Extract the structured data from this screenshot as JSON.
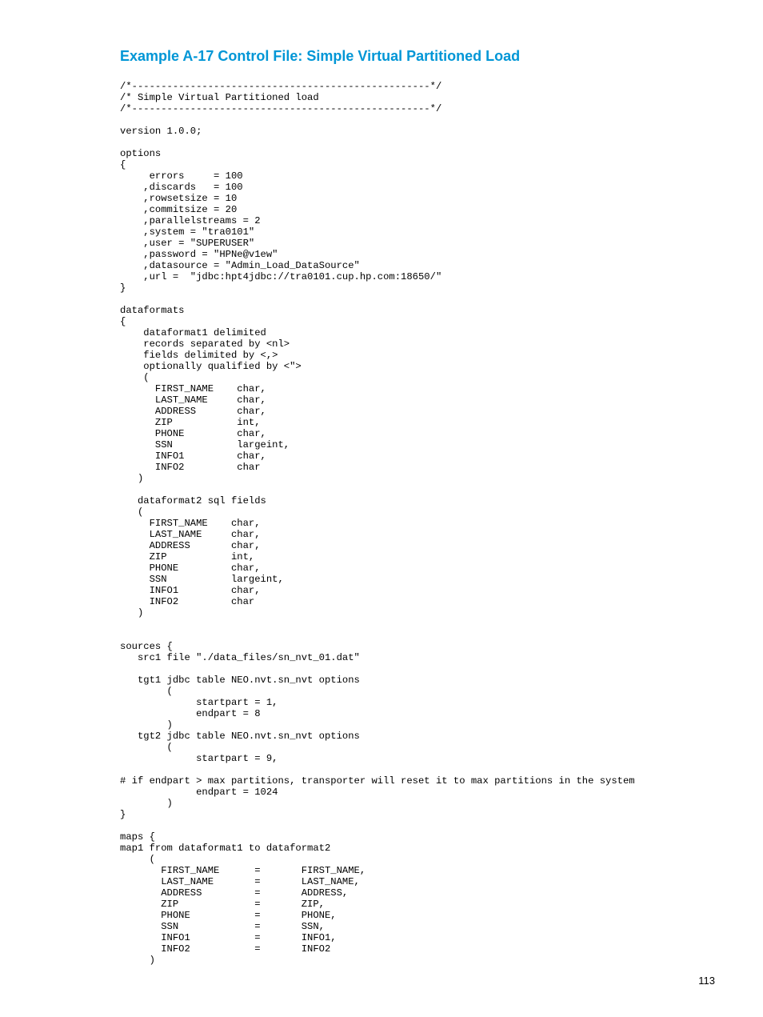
{
  "title": "Example A-17 Control File: Simple Virtual Partitioned Load",
  "code": "/*---------------------------------------------------*/\n/* Simple Virtual Partitioned load\n/*---------------------------------------------------*/\n\nversion 1.0.0;\n\noptions\n{\n     errors     = 100\n    ,discards   = 100\n    ,rowsetsize = 10\n    ,commitsize = 20\n    ,parallelstreams = 2\n    ,system = \"tra0101\"\n    ,user = \"SUPERUSER\"\n    ,password = \"HPNe@v1ew\"\n    ,datasource = \"Admin_Load_DataSource\"\n    ,url =  \"jdbc:hpt4jdbc://tra0101.cup.hp.com:18650/\"\n}\n\ndataformats\n{\n    dataformat1 delimited\n    records separated by <nl>\n    fields delimited by <,>\n    optionally qualified by <\">\n    (\n      FIRST_NAME    char,\n      LAST_NAME     char,\n      ADDRESS       char,\n      ZIP           int,\n      PHONE         char,\n      SSN           largeint,\n      INFO1         char,\n      INFO2         char\n   )\n\n   dataformat2 sql fields\n   (\n     FIRST_NAME    char,\n     LAST_NAME     char,\n     ADDRESS       char,\n     ZIP           int,\n     PHONE         char,\n     SSN           largeint,\n     INFO1         char,\n     INFO2         char\n   )\n\n\nsources {\n   src1 file \"./data_files/sn_nvt_01.dat\"\n\n   tgt1 jdbc table NEO.nvt.sn_nvt options\n        (\n             startpart = 1,\n             endpart = 8\n        )\n   tgt2 jdbc table NEO.nvt.sn_nvt options\n        (\n             startpart = 9,\n\n# if endpart > max partitions, transporter will reset it to max partitions in the system\n             endpart = 1024\n        )\n}\n\nmaps {\nmap1 from dataformat1 to dataformat2\n     (\n       FIRST_NAME      =       FIRST_NAME,\n       LAST_NAME       =       LAST_NAME,\n       ADDRESS         =       ADDRESS,\n       ZIP             =       ZIP,\n       PHONE           =       PHONE,\n       SSN             =       SSN,\n       INFO1           =       INFO1,\n       INFO2           =       INFO2\n     )",
  "page_number": "113"
}
